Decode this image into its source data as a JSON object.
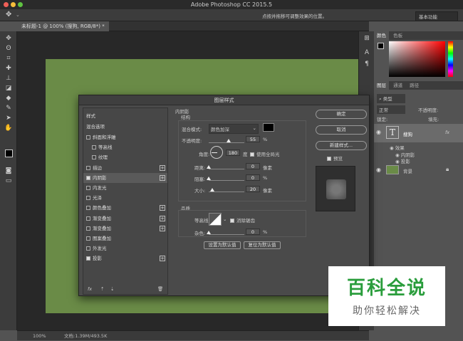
{
  "app_title": "Adobe Photoshop CC 2015.5",
  "options_hint": "点按并拖移可调整效果的位置。",
  "workspace": "基本功能",
  "doc_tab": "未标题-1 @ 100% (搜狗, RGB/8*) *",
  "status": {
    "zoom": "100%",
    "doc": "文档:1.39M/493.5K"
  },
  "right_panel": {
    "color_tabs": [
      "颜色",
      "色板"
    ],
    "layers_tabs": [
      "图层",
      "通道",
      "路径"
    ],
    "kind_label": "类型",
    "blend_mode": "正常",
    "opacity_label": "不透明度:",
    "lock_label": "锁定:",
    "fill_label": "填充:",
    "layers": [
      {
        "name": "搜狗",
        "type": "text"
      },
      {
        "name": "背景",
        "type": "bg"
      }
    ],
    "effects_label": "效果",
    "effects": [
      "内阴影",
      "投影"
    ]
  },
  "dialog": {
    "title": "图层样式",
    "styles_header": "样式",
    "blend_options": "混合选项",
    "style_items": [
      {
        "label": "斜面和浮雕",
        "checked": false,
        "plus": false,
        "indent": false
      },
      {
        "label": "等高线",
        "checked": false,
        "plus": false,
        "indent": true
      },
      {
        "label": "纹理",
        "checked": false,
        "plus": false,
        "indent": true
      },
      {
        "label": "描边",
        "checked": false,
        "plus": true,
        "indent": false
      },
      {
        "label": "内阴影",
        "checked": true,
        "plus": true,
        "indent": false,
        "selected": true
      },
      {
        "label": "内发光",
        "checked": false,
        "plus": false,
        "indent": false
      },
      {
        "label": "光泽",
        "checked": false,
        "plus": false,
        "indent": false
      },
      {
        "label": "颜色叠加",
        "checked": false,
        "plus": true,
        "indent": false
      },
      {
        "label": "渐变叠加",
        "checked": false,
        "plus": true,
        "indent": false
      },
      {
        "label": "渐变叠加",
        "checked": false,
        "plus": true,
        "indent": false
      },
      {
        "label": "图案叠加",
        "checked": false,
        "plus": false,
        "indent": false
      },
      {
        "label": "外发光",
        "checked": false,
        "plus": false,
        "indent": false
      },
      {
        "label": "投影",
        "checked": true,
        "plus": true,
        "indent": false
      }
    ],
    "fx_label": "fx",
    "section_title": "内阴影",
    "structure": "结构",
    "blend_mode_label": "混合模式:",
    "blend_mode_value": "颜色加深",
    "opacity_label": "不透明度:",
    "opacity_value": "55",
    "opacity_level": 0.55,
    "pct": "%",
    "angle_label": "角度:",
    "angle_value": "180",
    "degree": "度",
    "global_light": "使用全局光",
    "distance_label": "距离:",
    "distance_value": "0",
    "px": "像素",
    "choke_label": "阻塞:",
    "choke_value": "0",
    "size_label": "大小:",
    "size_value": "20",
    "size_level": 0.1,
    "quality": "品质",
    "contour_label": "等高线:",
    "antialias": "消除锯齿",
    "noise_label": "杂色:",
    "noise_value": "0",
    "set_default": "设置为默认值",
    "reset_default": "复位为默认值",
    "ok": "确定",
    "cancel": "取消",
    "new_style": "新建样式...",
    "preview": "预览"
  },
  "watermark": {
    "title": "百科全说",
    "subtitle": "助你轻松解决"
  },
  "colors": {
    "canvas": "#6a8b47",
    "watermark_green": "#2a9d3c"
  }
}
